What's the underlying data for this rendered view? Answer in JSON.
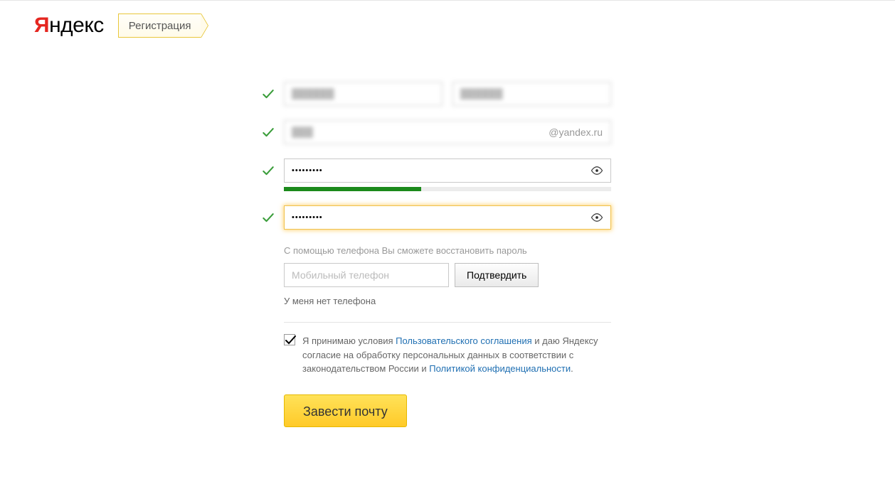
{
  "header": {
    "logo_y": "Я",
    "logo_rest": "ндекс",
    "badge": "Регистрация"
  },
  "form": {
    "first_name_value": "blurred",
    "last_name_value": "blurred",
    "login_value": "blurred",
    "login_suffix": "@yandex.ru",
    "password_value": "•••••••••",
    "password_confirm_value": "•••••••••",
    "phone_hint": "С помощью телефона Вы сможете восстановить пароль",
    "phone_placeholder": "Мобильный телефон",
    "confirm_button": "Подтвердить",
    "no_phone": "У меня нет телефона",
    "terms_prefix": "Я принимаю условия ",
    "terms_agreement_link": "Пользовательского соглашения",
    "terms_mid": " и даю Яндексу согласие на обработку персональных данных в соответствии с законодательством России и ",
    "terms_privacy_link": "Политикой конфиденциальности",
    "terms_suffix": ".",
    "submit_button": "Завести почту"
  }
}
